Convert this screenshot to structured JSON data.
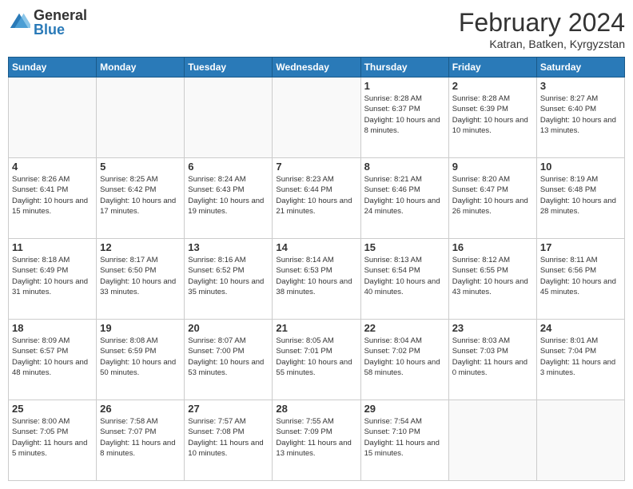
{
  "logo": {
    "general": "General",
    "blue": "Blue"
  },
  "title": "February 2024",
  "subtitle": "Katran, Batken, Kyrgyzstan",
  "days_of_week": [
    "Sunday",
    "Monday",
    "Tuesday",
    "Wednesday",
    "Thursday",
    "Friday",
    "Saturday"
  ],
  "weeks": [
    [
      {
        "day": "",
        "info": ""
      },
      {
        "day": "",
        "info": ""
      },
      {
        "day": "",
        "info": ""
      },
      {
        "day": "",
        "info": ""
      },
      {
        "day": "1",
        "info": "Sunrise: 8:28 AM\nSunset: 6:37 PM\nDaylight: 10 hours\nand 8 minutes."
      },
      {
        "day": "2",
        "info": "Sunrise: 8:28 AM\nSunset: 6:39 PM\nDaylight: 10 hours\nand 10 minutes."
      },
      {
        "day": "3",
        "info": "Sunrise: 8:27 AM\nSunset: 6:40 PM\nDaylight: 10 hours\nand 13 minutes."
      }
    ],
    [
      {
        "day": "4",
        "info": "Sunrise: 8:26 AM\nSunset: 6:41 PM\nDaylight: 10 hours\nand 15 minutes."
      },
      {
        "day": "5",
        "info": "Sunrise: 8:25 AM\nSunset: 6:42 PM\nDaylight: 10 hours\nand 17 minutes."
      },
      {
        "day": "6",
        "info": "Sunrise: 8:24 AM\nSunset: 6:43 PM\nDaylight: 10 hours\nand 19 minutes."
      },
      {
        "day": "7",
        "info": "Sunrise: 8:23 AM\nSunset: 6:44 PM\nDaylight: 10 hours\nand 21 minutes."
      },
      {
        "day": "8",
        "info": "Sunrise: 8:21 AM\nSunset: 6:46 PM\nDaylight: 10 hours\nand 24 minutes."
      },
      {
        "day": "9",
        "info": "Sunrise: 8:20 AM\nSunset: 6:47 PM\nDaylight: 10 hours\nand 26 minutes."
      },
      {
        "day": "10",
        "info": "Sunrise: 8:19 AM\nSunset: 6:48 PM\nDaylight: 10 hours\nand 28 minutes."
      }
    ],
    [
      {
        "day": "11",
        "info": "Sunrise: 8:18 AM\nSunset: 6:49 PM\nDaylight: 10 hours\nand 31 minutes."
      },
      {
        "day": "12",
        "info": "Sunrise: 8:17 AM\nSunset: 6:50 PM\nDaylight: 10 hours\nand 33 minutes."
      },
      {
        "day": "13",
        "info": "Sunrise: 8:16 AM\nSunset: 6:52 PM\nDaylight: 10 hours\nand 35 minutes."
      },
      {
        "day": "14",
        "info": "Sunrise: 8:14 AM\nSunset: 6:53 PM\nDaylight: 10 hours\nand 38 minutes."
      },
      {
        "day": "15",
        "info": "Sunrise: 8:13 AM\nSunset: 6:54 PM\nDaylight: 10 hours\nand 40 minutes."
      },
      {
        "day": "16",
        "info": "Sunrise: 8:12 AM\nSunset: 6:55 PM\nDaylight: 10 hours\nand 43 minutes."
      },
      {
        "day": "17",
        "info": "Sunrise: 8:11 AM\nSunset: 6:56 PM\nDaylight: 10 hours\nand 45 minutes."
      }
    ],
    [
      {
        "day": "18",
        "info": "Sunrise: 8:09 AM\nSunset: 6:57 PM\nDaylight: 10 hours\nand 48 minutes."
      },
      {
        "day": "19",
        "info": "Sunrise: 8:08 AM\nSunset: 6:59 PM\nDaylight: 10 hours\nand 50 minutes."
      },
      {
        "day": "20",
        "info": "Sunrise: 8:07 AM\nSunset: 7:00 PM\nDaylight: 10 hours\nand 53 minutes."
      },
      {
        "day": "21",
        "info": "Sunrise: 8:05 AM\nSunset: 7:01 PM\nDaylight: 10 hours\nand 55 minutes."
      },
      {
        "day": "22",
        "info": "Sunrise: 8:04 AM\nSunset: 7:02 PM\nDaylight: 10 hours\nand 58 minutes."
      },
      {
        "day": "23",
        "info": "Sunrise: 8:03 AM\nSunset: 7:03 PM\nDaylight: 11 hours\nand 0 minutes."
      },
      {
        "day": "24",
        "info": "Sunrise: 8:01 AM\nSunset: 7:04 PM\nDaylight: 11 hours\nand 3 minutes."
      }
    ],
    [
      {
        "day": "25",
        "info": "Sunrise: 8:00 AM\nSunset: 7:05 PM\nDaylight: 11 hours\nand 5 minutes."
      },
      {
        "day": "26",
        "info": "Sunrise: 7:58 AM\nSunset: 7:07 PM\nDaylight: 11 hours\nand 8 minutes."
      },
      {
        "day": "27",
        "info": "Sunrise: 7:57 AM\nSunset: 7:08 PM\nDaylight: 11 hours\nand 10 minutes."
      },
      {
        "day": "28",
        "info": "Sunrise: 7:55 AM\nSunset: 7:09 PM\nDaylight: 11 hours\nand 13 minutes."
      },
      {
        "day": "29",
        "info": "Sunrise: 7:54 AM\nSunset: 7:10 PM\nDaylight: 11 hours\nand 15 minutes."
      },
      {
        "day": "",
        "info": ""
      },
      {
        "day": "",
        "info": ""
      }
    ]
  ]
}
